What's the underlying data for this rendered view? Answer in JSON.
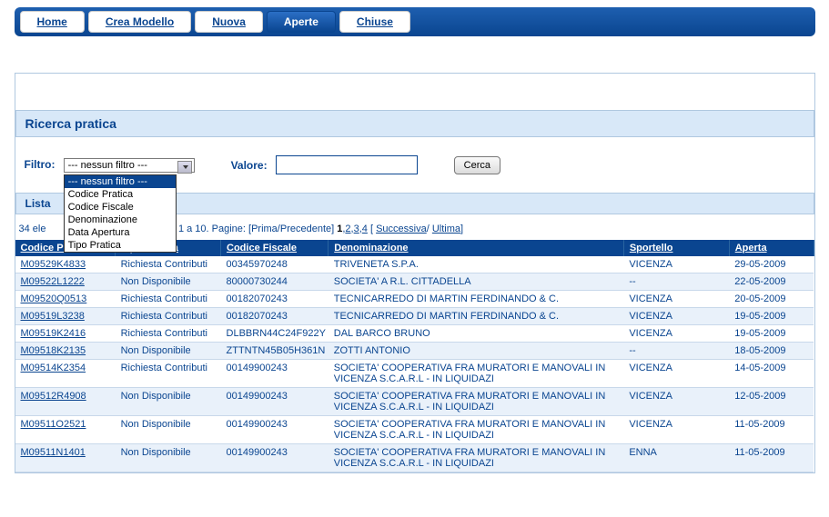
{
  "menu": {
    "tabs": [
      "Home",
      "Crea Modello",
      "Nuova",
      "Aperte",
      "Chiuse"
    ],
    "active_index": 3
  },
  "search": {
    "title": "Ricerca pratica",
    "filter_label": "Filtro:",
    "filter_selected": "--- nessun filtro ---",
    "filter_options": [
      "--- nessun filtro ---",
      "Codice Pratica",
      "Codice Fiscale",
      "Denominazione",
      "Data Apertura",
      "Tipo Pratica"
    ],
    "value_label": "Valore:",
    "value": "",
    "button": "Cerca"
  },
  "list": {
    "bar": "Lista",
    "pager_prefix": "34 ele",
    "pager_mid": "zati da 1 a 10. Pagine: ",
    "pager_prev": "[Prima/Precedente]",
    "pager_pages": [
      "1",
      "2",
      "3",
      "4"
    ],
    "pager_succ": "Successiva",
    "pager_last": "Ultima",
    "columns": [
      "Codice Pratica",
      "Tipo Pratica",
      "Codice Fiscale",
      "Denominazione",
      "Sportello",
      "Aperta"
    ],
    "rows": [
      {
        "cp": "M09529K4833",
        "tp": "Richiesta Contributi",
        "cf": "00345970248",
        "den": "TRIVENETA S.P.A.",
        "sp": "VICENZA",
        "ap": "29-05-2009"
      },
      {
        "cp": "M09522L1222",
        "tp": "Non Disponibile",
        "cf": "80000730244",
        "den": "SOCIETA' A R.L. CITTADELLA",
        "sp": "--",
        "ap": "22-05-2009"
      },
      {
        "cp": "M09520Q0513",
        "tp": "Richiesta Contributi",
        "cf": "00182070243",
        "den": "TECNICARREDO DI MARTIN FERDINANDO & C.",
        "sp": "VICENZA",
        "ap": "20-05-2009"
      },
      {
        "cp": "M09519L3238",
        "tp": "Richiesta Contributi",
        "cf": "00182070243",
        "den": "TECNICARREDO DI MARTIN FERDINANDO & C.",
        "sp": "VICENZA",
        "ap": "19-05-2009"
      },
      {
        "cp": "M09519K2416",
        "tp": "Richiesta Contributi",
        "cf": "DLBBRN44C24F922Y",
        "den": "DAL BARCO BRUNO",
        "sp": "VICENZA",
        "ap": "19-05-2009"
      },
      {
        "cp": "M09518K2135",
        "tp": "Non Disponibile",
        "cf": "ZTTNTN45B05H361N",
        "den": "ZOTTI ANTONIO",
        "sp": "--",
        "ap": "18-05-2009"
      },
      {
        "cp": "M09514K2354",
        "tp": "Richiesta Contributi",
        "cf": "00149900243",
        "den": "SOCIETA' COOPERATIVA FRA MURATORI E MANOVALI IN VICENZA S.C.A.R.L - IN LIQUIDAZI",
        "sp": "VICENZA",
        "ap": "14-05-2009"
      },
      {
        "cp": "M09512R4908",
        "tp": "Non Disponibile",
        "cf": "00149900243",
        "den": "SOCIETA' COOPERATIVA FRA MURATORI E MANOVALI IN VICENZA S.C.A.R.L - IN LIQUIDAZI",
        "sp": "VICENZA",
        "ap": "12-05-2009"
      },
      {
        "cp": "M09511O2521",
        "tp": "Non Disponibile",
        "cf": "00149900243",
        "den": "SOCIETA' COOPERATIVA FRA MURATORI E MANOVALI IN VICENZA S.C.A.R.L - IN LIQUIDAZI",
        "sp": "VICENZA",
        "ap": "11-05-2009"
      },
      {
        "cp": "M09511N1401",
        "tp": "Non Disponibile",
        "cf": "00149900243",
        "den": "SOCIETA' COOPERATIVA FRA MURATORI E MANOVALI IN VICENZA S.C.A.R.L - IN LIQUIDAZI",
        "sp": "ENNA",
        "ap": "11-05-2009"
      }
    ]
  }
}
